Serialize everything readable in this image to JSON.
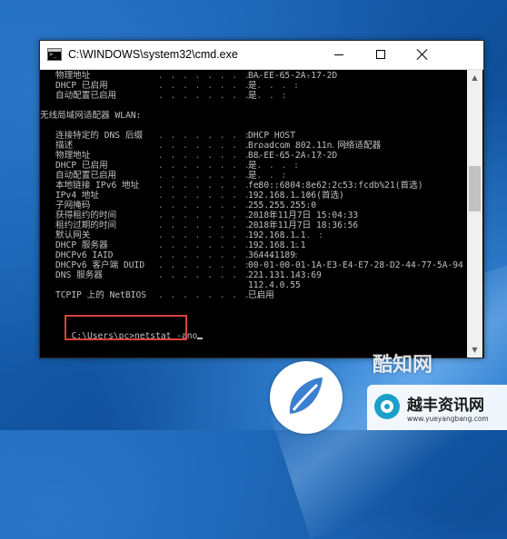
{
  "window": {
    "title": "C:\\WINDOWS\\system32\\cmd.exe"
  },
  "console": {
    "pre_rows": [
      {
        "label": "物理地址",
        "dots": ". . . . . . . . . . . . .",
        "value": "BA-EE-65-2A-17-2D"
      },
      {
        "label": "DHCP 已启用",
        "dots": ". . . . . . . . . . . :",
        "value": "是"
      },
      {
        "label": "自动配置已启用",
        "dots": ". . . . . . . . . . :",
        "value": "是"
      }
    ],
    "section_header": "无线局域网适配器 WLAN:",
    "rows": [
      {
        "label": "连接特定的 DNS 后缀",
        "dots": ". . . . . . . :",
        "value": "DHCP HOST"
      },
      {
        "label": "描述",
        "dots": ". . . . . . . . . . . . . . . :",
        "value": "Broadcom 802.11n 网络适配器"
      },
      {
        "label": "物理地址",
        "dots": ". . . . . . . . . . . . . :",
        "value": "B8-EE-65-2A-17-2D"
      },
      {
        "label": "DHCP 已启用",
        "dots": ". . . . . . . . . . . :",
        "value": "是"
      },
      {
        "label": "自动配置已启用",
        "dots": ". . . . . . . . . . :",
        "value": "是"
      },
      {
        "label": "本地链接 IPv6 地址",
        "dots": ". . . . . . . . :",
        "value": "fe80::6804:8e62:2c53:fcdb%21(首选)"
      },
      {
        "label": "IPv4 地址",
        "dots": ". . . . . . . . . . . . :",
        "value": "192.168.1.106(首选)"
      },
      {
        "label": "子网掩码",
        "dots": ". . . . . . . . . . . . :",
        "value": "255.255.255.0"
      },
      {
        "label": "获得租约的时间",
        "dots": ". . . . . . . . . :",
        "value": "2018年11月7日 15:04:33"
      },
      {
        "label": "租约过期的时间",
        "dots": ". . . . . . . . . :",
        "value": "2018年11月7日 18:36:56"
      },
      {
        "label": "默认网关",
        "dots": ". . . . . . . . . . . . . :",
        "value": "192.168.1.1"
      },
      {
        "label": "DHCP 服务器",
        "dots": ". . . . . . . . . . . :",
        "value": "192.168.1.1"
      },
      {
        "label": "DHCPv6 IAID",
        "dots": ". . . . . . . . . . . :",
        "value": "364441189"
      },
      {
        "label": "DHCPv6 客户端 DUID",
        "dots": ". . . . . . . :",
        "value": "00-01-00-01-1A-E3-E4-E7-28-D2-44-77-5A-94"
      },
      {
        "label": "DNS 服务器",
        "dots": ". . . . . . . . . . . . :",
        "value": "221.131.143.69"
      },
      {
        "label": "",
        "dots": "",
        "value": "112.4.0.55"
      },
      {
        "label": "TCPIP 上的 NetBIOS",
        "dots": ". . . . . . . . :",
        "value": "已启用"
      }
    ],
    "prompt": "C:\\Users\\pc>",
    "command": "netstat -ano"
  },
  "watermark": {
    "logo_text": "酷知网",
    "brand_name": "越丰资讯网",
    "brand_url": "www.yueyangbang.com"
  },
  "colors": {
    "console_bg": "#000000",
    "console_text": "#c0c0c0",
    "highlight_border": "#d9433c",
    "desktop_blue": "#1b5fa8"
  },
  "icons": {
    "app": "cmd-icon",
    "minimize": "minimize-icon",
    "maximize": "maximize-icon",
    "close": "close-icon"
  }
}
